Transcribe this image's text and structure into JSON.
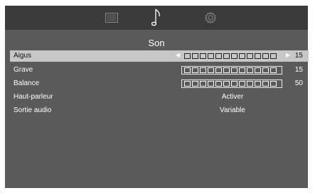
{
  "topbar": {
    "tabs": [
      {
        "icon": "image-grid-icon",
        "active": false
      },
      {
        "icon": "music-note-icon",
        "active": true
      },
      {
        "icon": "gear-icon",
        "active": false
      }
    ]
  },
  "title": "Son",
  "rows": [
    {
      "label": "Aigus",
      "type": "slider",
      "value": "15",
      "level": 0.0
    },
    {
      "label": "Grave",
      "type": "slider",
      "value": "15",
      "level": 0.0
    },
    {
      "label": "Balance",
      "type": "slider",
      "value": "50",
      "level": 0.0
    },
    {
      "label": "Haut-parleur",
      "type": "option",
      "value": "Activer"
    },
    {
      "label": "Sortie audio",
      "type": "option",
      "value": "Variable"
    }
  ],
  "colors": {
    "panel": "#5a5a5a",
    "topbar": "#3b3b3b",
    "highlight": "#c7c7c7"
  }
}
